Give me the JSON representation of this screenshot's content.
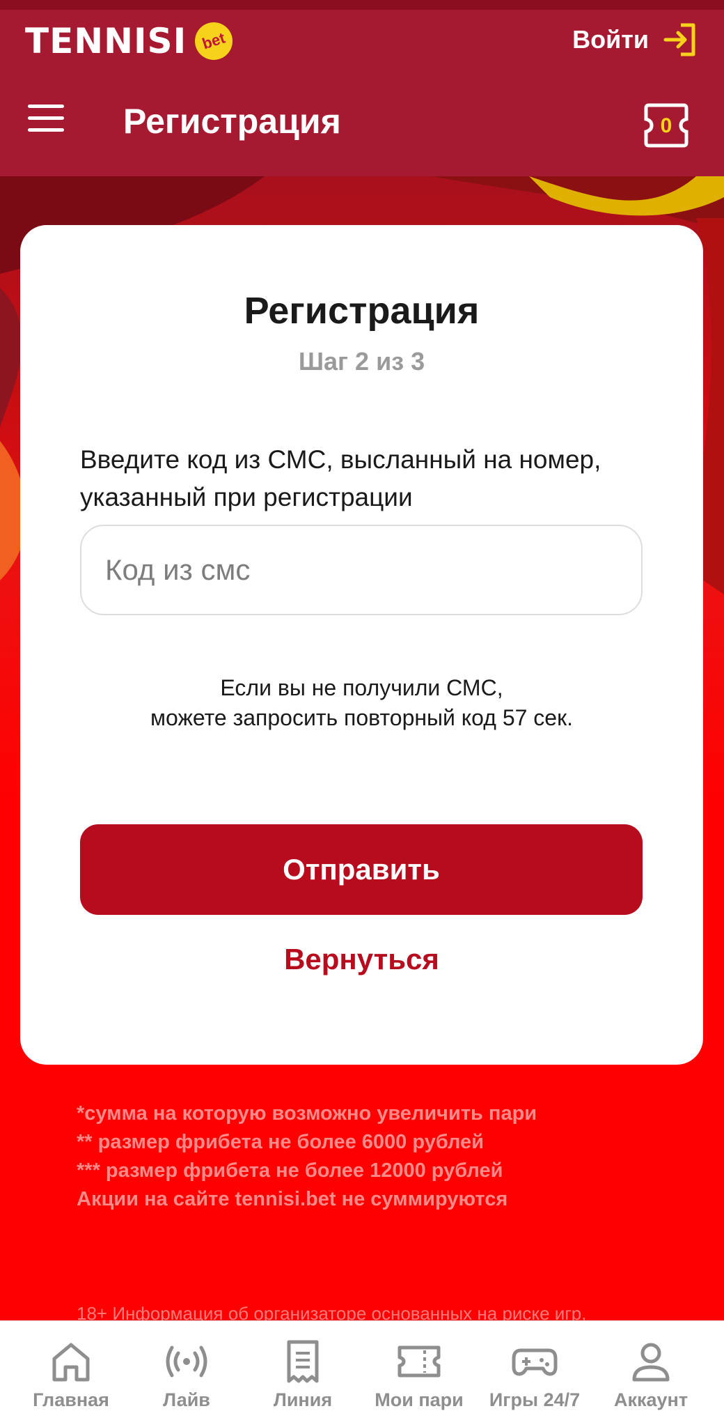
{
  "header": {
    "logo_text": "TENNISI",
    "logo_badge": "bet",
    "login_label": "Войти",
    "title": "Регистрация",
    "coupon_count": "0"
  },
  "card": {
    "title": "Регистрация",
    "step": "Шаг 2 из 3",
    "instruction": "Введите код из СМС, высланный на номер, указанный при регистрации",
    "code_placeholder": "Код из смс",
    "code_value": "",
    "resend_line1": "Если вы не получили СМС,",
    "resend_line2": "можете запросить повторный код 57 сек.",
    "submit_label": "Отправить",
    "back_label": "Вернуться"
  },
  "footnotes": [
    "*сумма на которую возможно увеличить пари",
    "** размер фрибета не более 6000 рублей",
    "*** размер фрибета не более 12000 рублей",
    "Акции на сайте tennisi.bet не суммируются"
  ],
  "legal_text": "18+ Информация об организаторе основанных на риске игр,",
  "nav": [
    {
      "label": "Главная",
      "icon": "home-icon"
    },
    {
      "label": "Лайв",
      "icon": "live-broadcast-icon"
    },
    {
      "label": "Линия",
      "icon": "receipt-icon"
    },
    {
      "label": "Мои пари",
      "icon": "ticket-icon"
    },
    {
      "label": "Игры 24/7",
      "icon": "gamepad-icon"
    },
    {
      "label": "Аккаунт",
      "icon": "user-icon"
    }
  ],
  "colors": {
    "header_bg": "#a51a30",
    "accent_red": "#b70b1e",
    "page_red": "#ff0000",
    "logo_yellow": "#f6d31a"
  }
}
